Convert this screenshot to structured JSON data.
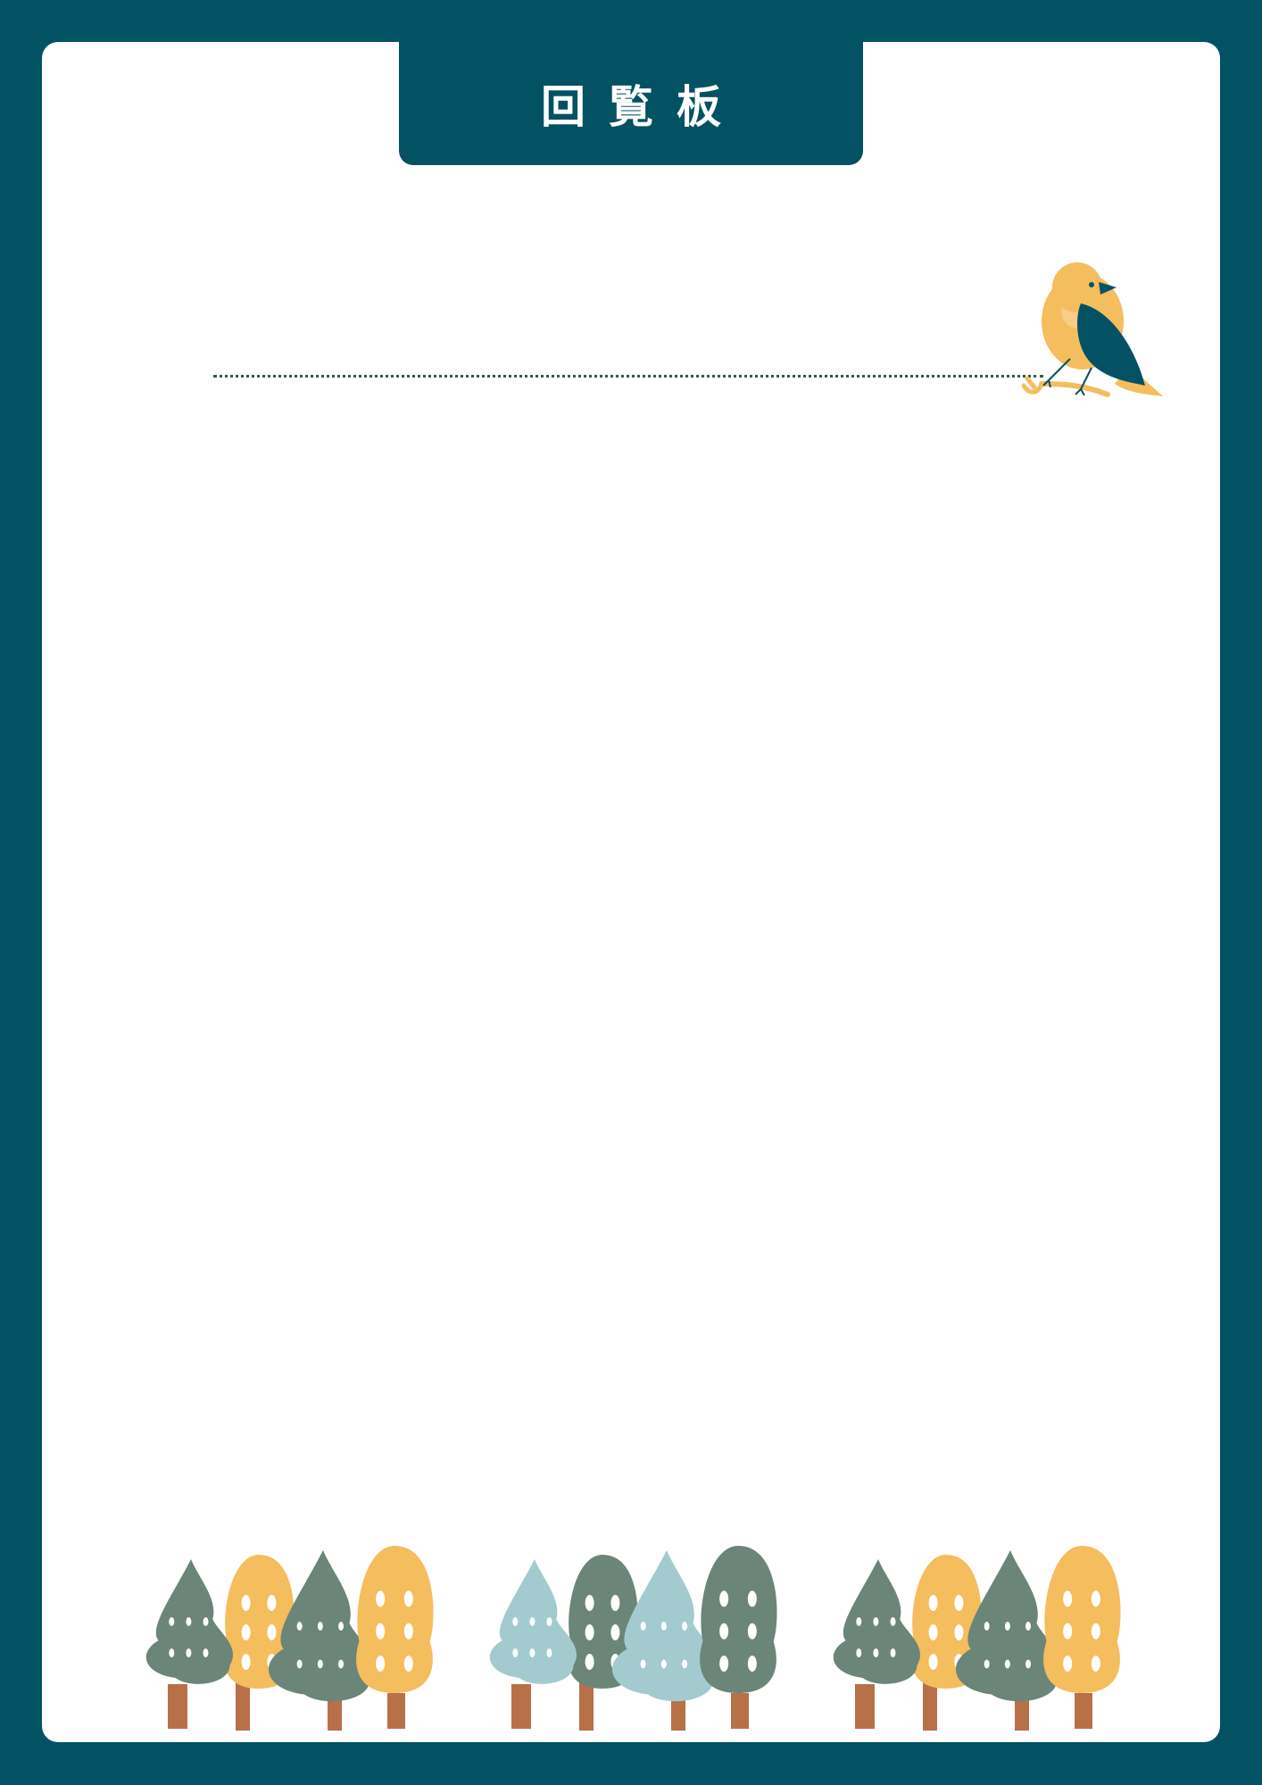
{
  "header": {
    "title": "回覧板"
  },
  "colors": {
    "frame": "#025263",
    "paper": "#ffffff",
    "yellow": "#f4bd5d",
    "dark_green": "#6b8578",
    "light_blue": "#a3cbcf",
    "trunk": "#b87049",
    "dotted_line": "#2f5a57"
  },
  "decorations": {
    "bird": "bird-on-branch-icon",
    "trees": "forest-tree-icons"
  }
}
